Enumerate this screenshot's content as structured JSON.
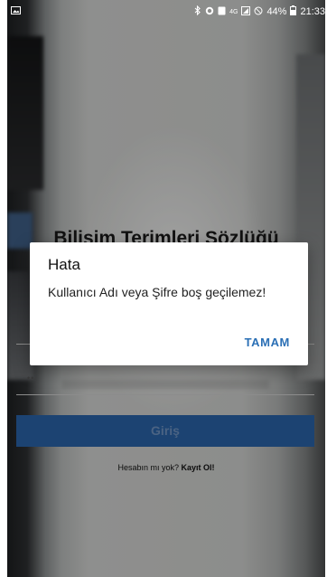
{
  "status_bar": {
    "left_icon": "image-notification-icon",
    "battery_percent": "44%",
    "time": "21:33",
    "network_label": "4G"
  },
  "app": {
    "title": "Bilişim Terimleri Sözlüğü",
    "login_button": "Giriş",
    "signup_prompt": "Hesabın mı yok?",
    "signup_link": "Kayıt Ol!",
    "password_mask": "••"
  },
  "dialog": {
    "title": "Hata",
    "message": "Kullanıcı Adı veya Şifre boş geçilemez!",
    "ok_button": "TAMAM"
  },
  "colors": {
    "button_bg": "#2a64a8",
    "dialog_action": "#2a6fb5"
  }
}
